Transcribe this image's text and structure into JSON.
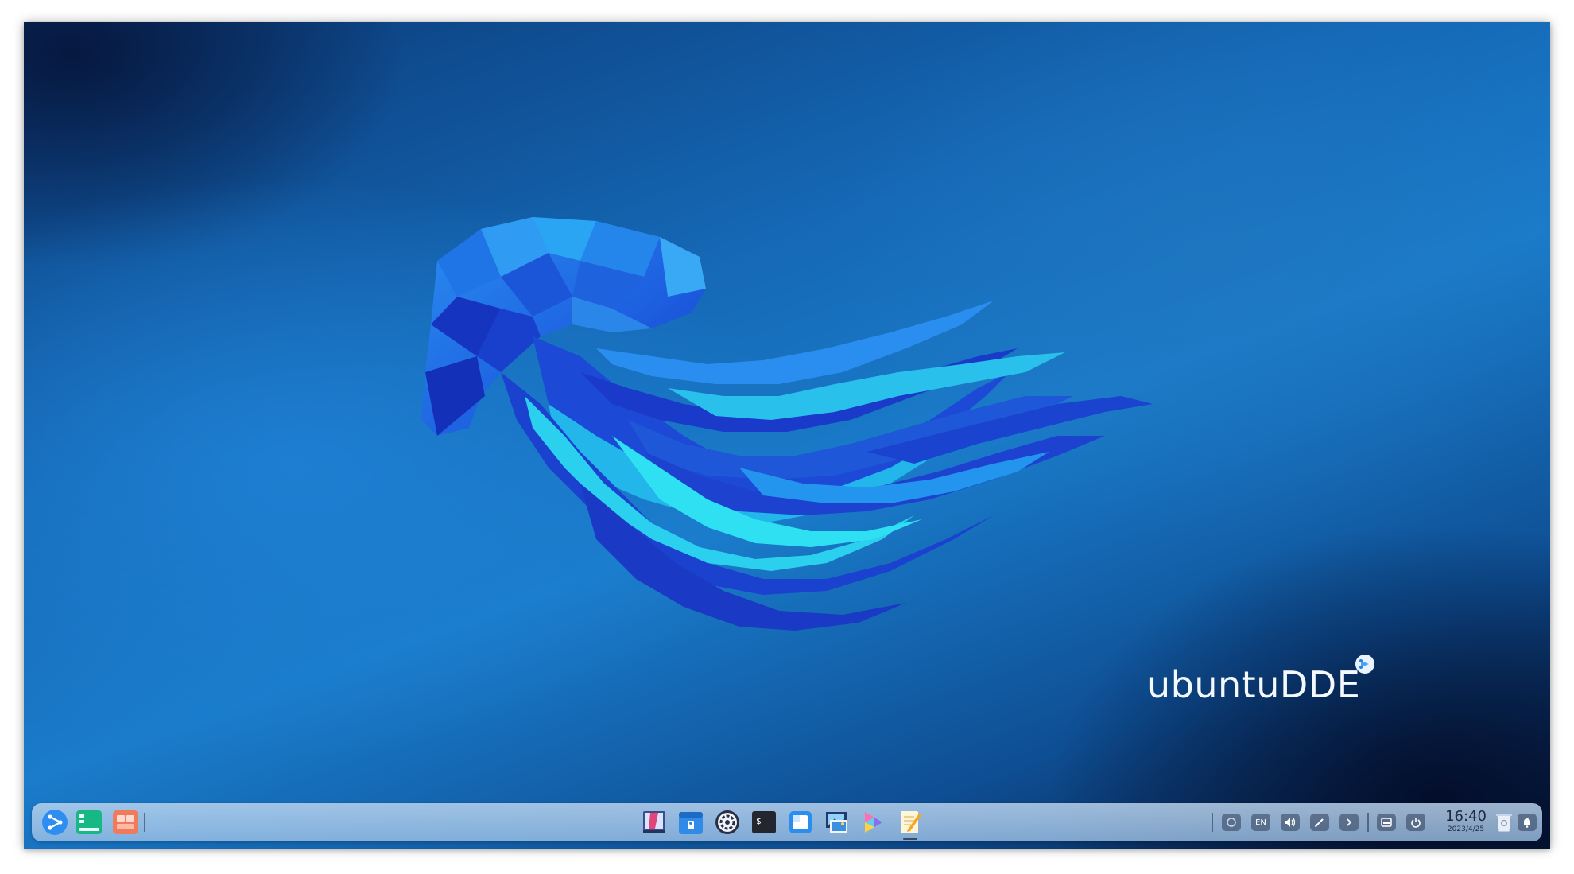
{
  "desktop": {
    "brand_text": "ubuntuDDE"
  },
  "dock": {
    "left_apps": [
      {
        "name": "launcher-icon"
      },
      {
        "name": "multitasking-view-icon"
      },
      {
        "name": "workspace-icon"
      }
    ],
    "center_apps": [
      {
        "name": "file-manager-icon"
      },
      {
        "name": "app-store-icon"
      },
      {
        "name": "control-center-icon"
      },
      {
        "name": "terminal-icon",
        "glyph": "$"
      },
      {
        "name": "document-viewer-icon"
      },
      {
        "name": "image-viewer-icon"
      },
      {
        "name": "color-picker-icon"
      },
      {
        "name": "text-editor-icon"
      }
    ],
    "tray": {
      "keyboard_layout": "EN",
      "clock_time": "16:40",
      "clock_date": "2023/4/25"
    }
  },
  "colors": {
    "wallpaper_dark": "#071a3e",
    "wallpaper_mid": "#1a7ccb",
    "dock_bg": "#b4d2ef",
    "jellyfish_dark": "#1a3fd1",
    "jellyfish_light": "#2fd0ec"
  }
}
